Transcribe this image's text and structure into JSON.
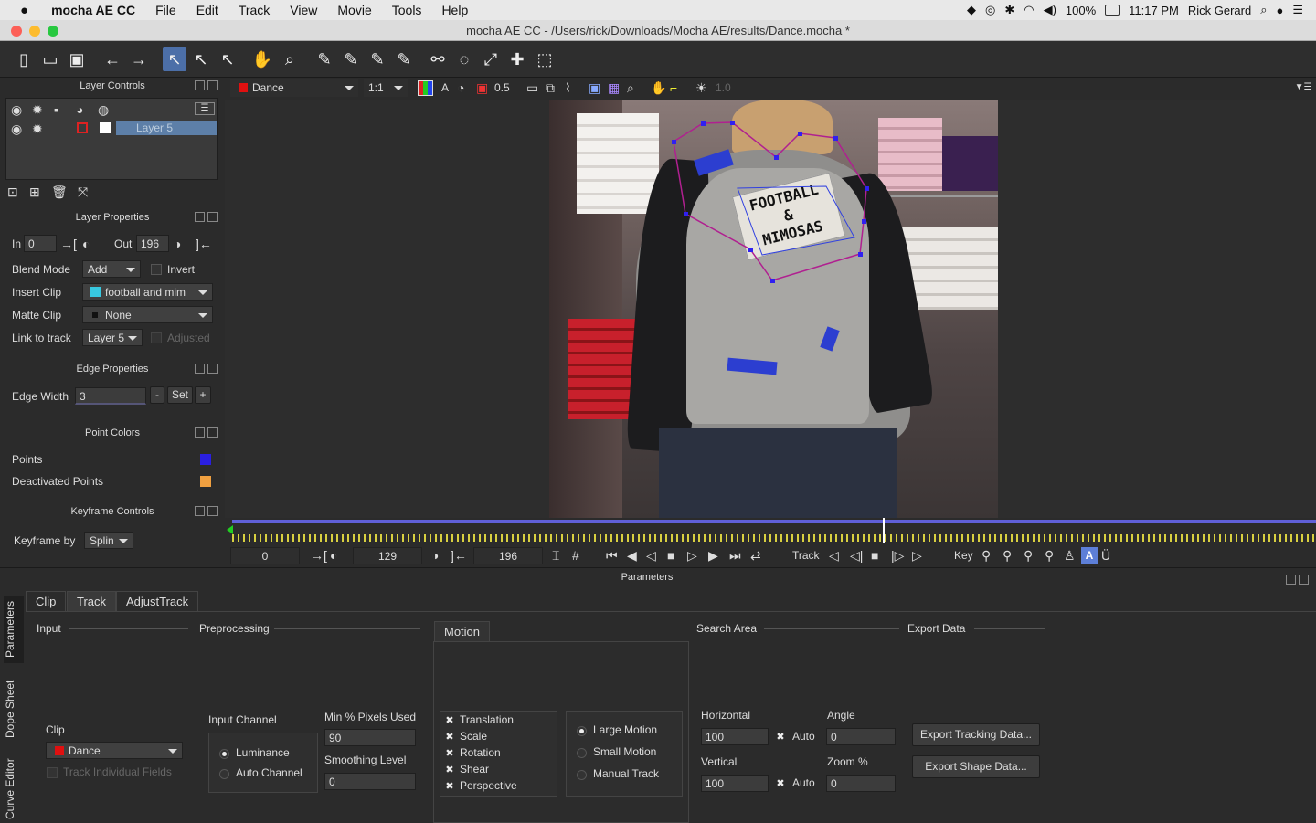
{
  "menubar": {
    "apple": "",
    "app": "mocha AE CC",
    "items": [
      "File",
      "Edit",
      "Track",
      "View",
      "Movie",
      "Tools",
      "Help"
    ],
    "battery": "100%",
    "time": "11:17 PM",
    "user": "Rick Gerard"
  },
  "window": {
    "title": "mocha AE CC - /Users/rick/Downloads/Mocha AE/results/Dance.mocha *"
  },
  "layer_controls": {
    "title": "Layer Controls",
    "layers": [
      {
        "name": "Layer 5"
      }
    ]
  },
  "layer_properties": {
    "title": "Layer Properties",
    "in_label": "In",
    "in_value": "0",
    "out_label": "Out",
    "out_value": "196",
    "blend_label": "Blend Mode",
    "blend_value": "Add",
    "invert_label": "Invert",
    "insert_label": "Insert Clip",
    "insert_value": "football and mim",
    "matte_label": "Matte Clip",
    "matte_value": "None",
    "link_label": "Link to track",
    "link_value": "Layer 5",
    "adjusted_label": "Adjusted"
  },
  "edge_properties": {
    "title": "Edge Properties",
    "width_label": "Edge Width",
    "width_value": "3",
    "minus": "-",
    "set": "Set",
    "plus": "+"
  },
  "point_colors": {
    "title": "Point Colors",
    "points_label": "Points",
    "deactivated_label": "Deactivated Points",
    "points_color": "#2a1fe0",
    "deactivated_color": "#f0a040"
  },
  "keyframe_controls": {
    "title": "Keyframe Controls",
    "by_label": "Keyframe by",
    "by_value": "Splin"
  },
  "viewer_toolbar": {
    "clip": "Dance",
    "zoom": "1:1",
    "a_label": "A",
    "opacity": "0.5",
    "gamma": "1.0"
  },
  "shirt_text": [
    "FOOTBALL",
    "&",
    "MIMOSAS"
  ],
  "timeline": {
    "start": "0",
    "in": "129",
    "out": "196",
    "track_label": "Track",
    "key_label": "Key",
    "playhead": 0.6
  },
  "parameters": {
    "title": "Parameters",
    "tabs": [
      "Clip",
      "Track",
      "AdjustTrack"
    ],
    "side_tabs": [
      "Parameters",
      "Dope Sheet",
      "Curve Editor"
    ],
    "input": {
      "header": "Input",
      "clip_label": "Clip",
      "clip_value": "Dance",
      "track_fields": "Track Individual Fields"
    },
    "preprocessing": {
      "header": "Preprocessing",
      "channel_label": "Input Channel",
      "luminance": "Luminance",
      "auto_channel": "Auto Channel",
      "min_label": "Min % Pixels Used",
      "min_value": "90",
      "smooth_label": "Smoothing Level",
      "smooth_value": "0"
    },
    "motion": {
      "header": "Motion",
      "options": [
        "Translation",
        "Scale",
        "Rotation",
        "Shear",
        "Perspective"
      ],
      "large": "Large Motion",
      "small": "Small Motion",
      "manual": "Manual Track"
    },
    "search_area": {
      "header": "Search Area",
      "horizontal": "Horizontal",
      "h_value": "100",
      "auto": "Auto",
      "angle": "Angle",
      "angle_value": "0",
      "vertical": "Vertical",
      "v_value": "100",
      "zoom": "Zoom %",
      "zoom_value": "0"
    },
    "export_data": {
      "header": "Export Data",
      "tracking": "Export Tracking Data...",
      "shape": "Export Shape Data..."
    }
  }
}
